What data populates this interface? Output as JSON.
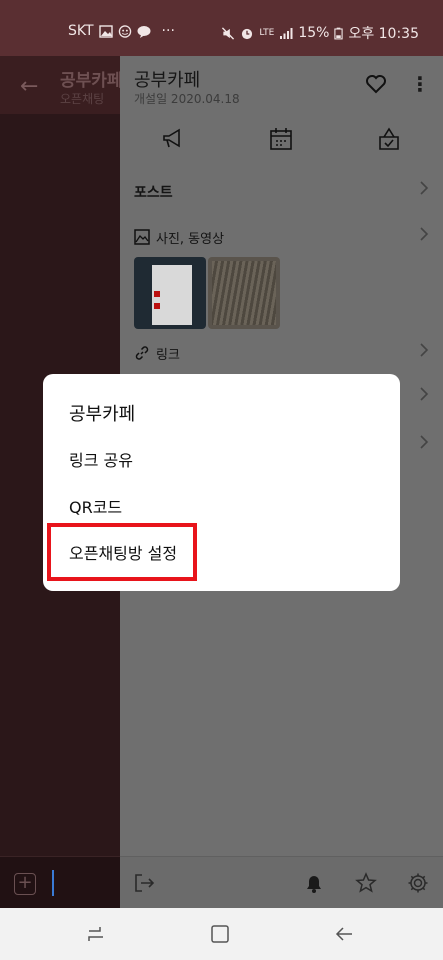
{
  "status_bar": {
    "carrier": "SKT",
    "more": "···",
    "network": "LTE",
    "battery": "15%",
    "time": "오후 10:35"
  },
  "chat": {
    "title": "공부카페",
    "subtitle": "오픈채팅"
  },
  "drawer": {
    "title": "공부카페",
    "date": "개설일 2020.04.18",
    "section_post": "포스트",
    "section_media": "사진, 동영상",
    "section_link": "링크"
  },
  "dialog": {
    "title": "공부카페",
    "items": [
      "링크 공유",
      "QR코드",
      "오픈채팅방 설정"
    ],
    "highlight_color": "#e8141b"
  },
  "colors": {
    "status_bar": "#5a2f32",
    "chat_bg": "#2b1719",
    "drawer_dim": "#6f6f6f"
  }
}
